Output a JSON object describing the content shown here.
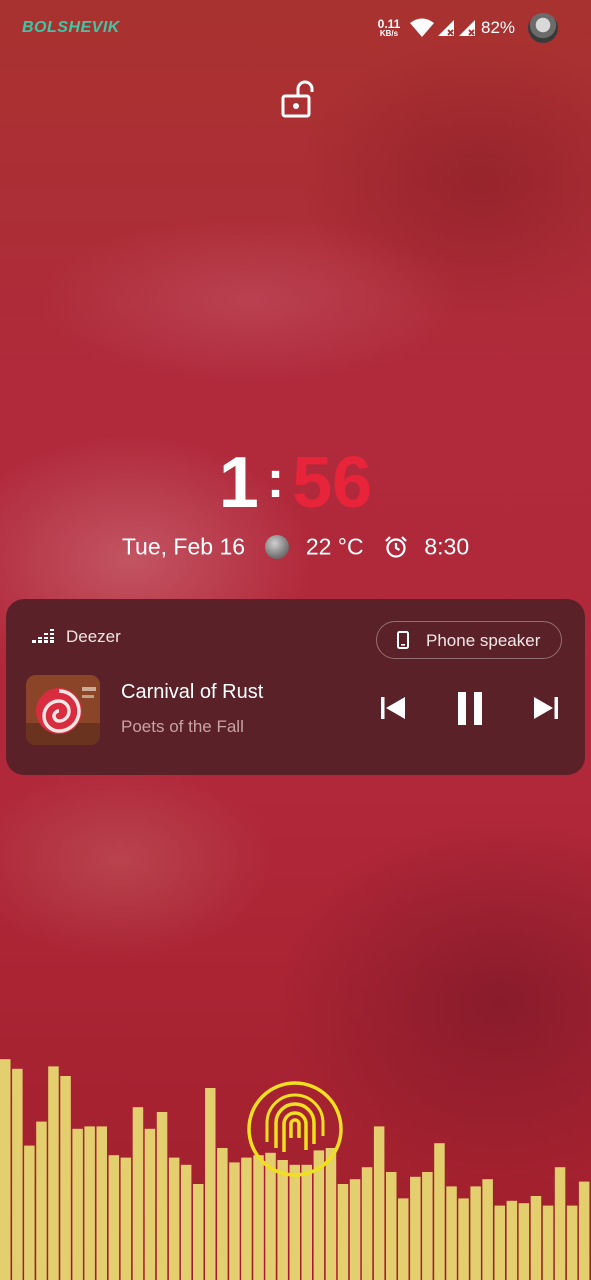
{
  "status_bar": {
    "carrier": "BOLSHEVIK",
    "net_speed": "0.11",
    "net_speed_unit": "KB/s",
    "battery": "82%",
    "icons": [
      "wifi-icon",
      "signal-icon",
      "signal-icon",
      "avatar"
    ]
  },
  "lock": {
    "icon": "unlocked-padlock-icon"
  },
  "clock": {
    "hour": "1",
    "separator": ":",
    "minutes": "56"
  },
  "date_line": {
    "date": "Tue, Feb 16",
    "weather_icon": "moon-cloud-icon",
    "temperature": "22 °C",
    "alarm_icon": "alarm-clock-icon",
    "alarm_time": "8:30"
  },
  "media": {
    "app_name": "Deezer",
    "output_device": "Phone speaker",
    "track_title": "Carnival of Rust",
    "artist": "Poets of the Fall",
    "controls": [
      "previous-icon",
      "pause-icon",
      "next-icon"
    ]
  },
  "colors": {
    "accent_minutes": "#e8243a",
    "carrier": "#3fc7a6",
    "visualizer": "#e3cf6e",
    "card": "#5a2228"
  },
  "visualizer": {
    "levels": [
      0.92,
      0.88,
      0.56,
      0.66,
      0.89,
      0.85,
      0.63,
      0.64,
      0.64,
      0.52,
      0.51,
      0.72,
      0.63,
      0.7,
      0.51,
      0.48,
      0.4,
      0.8,
      0.55,
      0.49,
      0.51,
      0.52,
      0.53,
      0.5,
      0.48,
      0.48,
      0.54,
      0.55,
      0.4,
      0.42,
      0.47,
      0.64,
      0.45,
      0.34,
      0.43,
      0.45,
      0.57,
      0.39,
      0.34,
      0.39,
      0.42,
      0.31,
      0.33,
      0.32,
      0.35,
      0.31,
      0.47,
      0.31,
      0.41
    ]
  }
}
